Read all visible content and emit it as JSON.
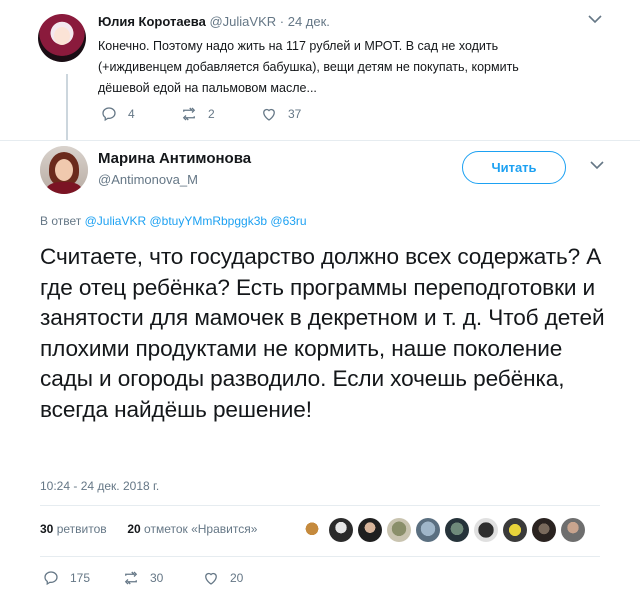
{
  "reply_tweet": {
    "author_name": "Юлия Коротаева",
    "author_handle": "@JuliaVKR",
    "date": "24 дек.",
    "text": "Конечно. Поэтому надо жить на 117 рублей и МРОТ. В сад не ходить (+иждивенцем добавляется бабушка), вещи детям не покупать, кормить дёшевой едой на пальмовом масле...",
    "replies": "4",
    "retweets": "2",
    "likes": "37"
  },
  "main_tweet": {
    "author_name": "Марина Антимонова",
    "author_handle": "@Antimonova_M",
    "follow_label": "Читать",
    "reply_prefix": "В ответ",
    "reply_handles": "@JuliaVKR @btuyYMmRbpggk3b @63ru",
    "text": "Считаете, что государство должно всех содержать?  А где отец ребёнка? Есть программы переподготовки и занятости для мамочек в декретном и т. д. Чтоб детей плохими продуктами не кормить, наше поколение сады и огороды разводило. Если хочешь ребёнка, всегда найдёшь решение!",
    "timestamp": "10:24 - 24 дек. 2018 г.",
    "retweets_count": "30",
    "retweets_label": "ретвитов",
    "likes_count": "20",
    "likes_label": "отметок «Нравится»",
    "replies": "175",
    "retweets": "30",
    "likes": "20"
  },
  "icons": [
    "chevron-down-icon",
    "reply-icon",
    "retweet-icon",
    "like-icon"
  ],
  "colors": {
    "accent": "#1da1f2",
    "secondary_text": "#657786",
    "primary_text": "#14171a",
    "divider": "#e6ecf0"
  }
}
